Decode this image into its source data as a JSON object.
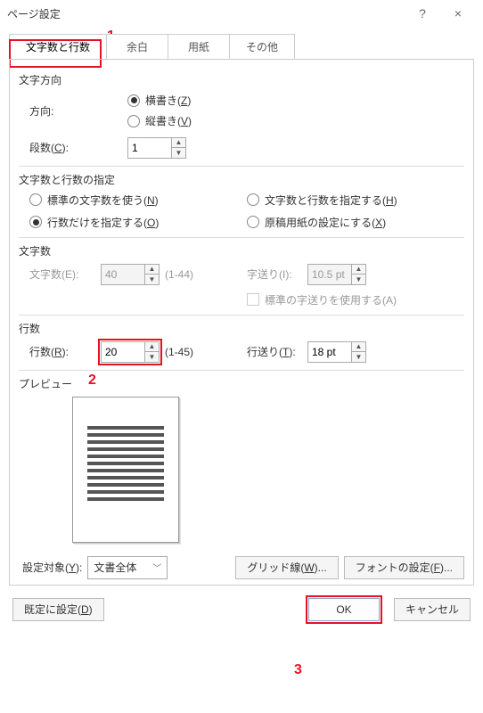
{
  "window": {
    "title": "ページ設定",
    "help": "?",
    "close": "×"
  },
  "tabs": {
    "items": [
      {
        "label": "文字数と行数",
        "name": "tab-chars-lines",
        "active": true
      },
      {
        "label": "余白",
        "name": "tab-margins",
        "active": false
      },
      {
        "label": "用紙",
        "name": "tab-paper",
        "active": false
      },
      {
        "label": "その他",
        "name": "tab-other",
        "active": false
      }
    ]
  },
  "direction": {
    "section_label": "文字方向",
    "direction_label": "方向:",
    "horizontal_pre": "横書き(",
    "horizontal_key": "Z",
    "close_paren": ")",
    "vertical_pre": "縦書き(",
    "vertical_key": "V",
    "columns_label_pre": "段数(",
    "columns_label_key": "C",
    "columns_label_post": "):",
    "columns_value": "1"
  },
  "spec": {
    "section_label": "文字数と行数の指定",
    "opt1_pre": "標準の文字数を使う(",
    "opt1_key": "N",
    "opt2_pre": "文字数と行数を指定する(",
    "opt2_key": "H",
    "opt3_pre": "行数だけを指定する(",
    "opt3_key": "O",
    "opt4_pre": "原稿用紙の設定にする(",
    "opt4_key": "X",
    "close": ")"
  },
  "chars": {
    "section_label": "文字数",
    "chars_label": "文字数(E):",
    "chars_value": "40",
    "chars_range": "(1-44)",
    "pitch_label": "字送り(I):",
    "pitch_value": "10.5 pt",
    "default_pitch_label": "標準の字送りを使用する(A)"
  },
  "lines": {
    "section_label": "行数",
    "lines_label_pre": "行数(",
    "lines_label_key": "R",
    "lines_label_post": "):",
    "lines_value": "20",
    "lines_range": "(1-45)",
    "line_pitch_label_pre": "行送り(",
    "line_pitch_label_key": "T",
    "line_pitch_label_post": "):",
    "line_pitch_value": "18 pt"
  },
  "preview": {
    "section_label": "プレビュー"
  },
  "apply_to": {
    "label_pre": "設定対象(",
    "label_key": "Y",
    "label_post": "):",
    "value": "文書全体",
    "gridlines_pre": "グリッド線(",
    "gridlines_key": "W",
    "gridlines_post": ")...",
    "font_pre": "フォントの設定(",
    "font_key": "F",
    "font_post": ")..."
  },
  "buttons": {
    "default_pre": "既定に設定(",
    "default_key": "D",
    "default_post": ")",
    "ok": "OK",
    "cancel": "キャンセル"
  },
  "callouts": {
    "one": "1",
    "two": "2",
    "three": "3"
  }
}
